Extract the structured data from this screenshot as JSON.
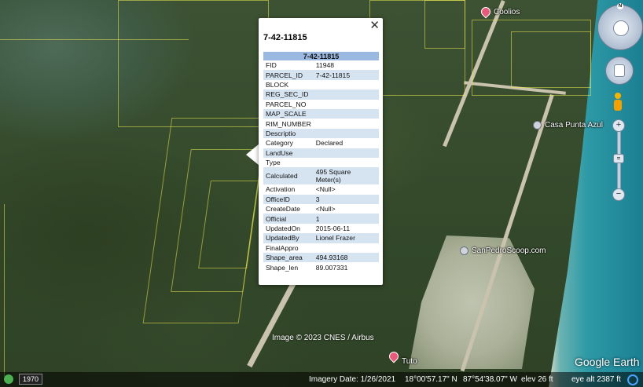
{
  "popup": {
    "title": "7-42-11815",
    "table_header": "7-42-11815",
    "rows": [
      {
        "k": "FID",
        "v": "11948"
      },
      {
        "k": "PARCEL_ID",
        "v": "7-42-11815"
      },
      {
        "k": "BLOCK",
        "v": ""
      },
      {
        "k": "REG_SEC_ID",
        "v": ""
      },
      {
        "k": "PARCEL_NO",
        "v": ""
      },
      {
        "k": "MAP_SCALE",
        "v": ""
      },
      {
        "k": "RIM_NUMBER",
        "v": ""
      },
      {
        "k": "Descriptio",
        "v": ""
      },
      {
        "k": "Category",
        "v": "Declared"
      },
      {
        "k": "LandUse",
        "v": ""
      },
      {
        "k": "Type",
        "v": ""
      },
      {
        "k": "Calculated",
        "v": "495 Square Meter(s)"
      },
      {
        "k": "Activation",
        "v": "<Null>"
      },
      {
        "k": "OfficeID",
        "v": "3"
      },
      {
        "k": "CreateDate",
        "v": "<Null>"
      },
      {
        "k": "Official",
        "v": "1"
      },
      {
        "k": "UpdatedOn",
        "v": "2015-06-11"
      },
      {
        "k": "UpdatedBy",
        "v": "Lionel Frazer"
      },
      {
        "k": "FinalAppro",
        "v": ""
      },
      {
        "k": "Shape_area",
        "v": "494.93168"
      },
      {
        "k": "Shape_len",
        "v": "89.007331"
      }
    ],
    "close_icon": "close-icon"
  },
  "places": {
    "coolios": "Coolios",
    "casa": "Casa Punta Azul",
    "scoop": "SanPedroScoop.com",
    "tuto": "Tuto"
  },
  "footer": {
    "copyright": "Image © 2023 CNES / Airbus",
    "logo": "Google Earth",
    "year": "1970",
    "imagery_date": "Imagery Date: 1/26/2021",
    "lat": "18°00'57.17\" N",
    "lon": "87°54'38.07\" W",
    "elev": "elev   26 ft",
    "eye_alt": "eye alt  2387 ft"
  },
  "nav": {
    "north": "N",
    "zoom_in": "+",
    "zoom_out": "−",
    "zoom_thumb": "="
  },
  "colors": {
    "parcel_lines": "#ebe650",
    "popup_header": "#9bb8e0",
    "popup_alt_row": "#d6e4f2"
  }
}
